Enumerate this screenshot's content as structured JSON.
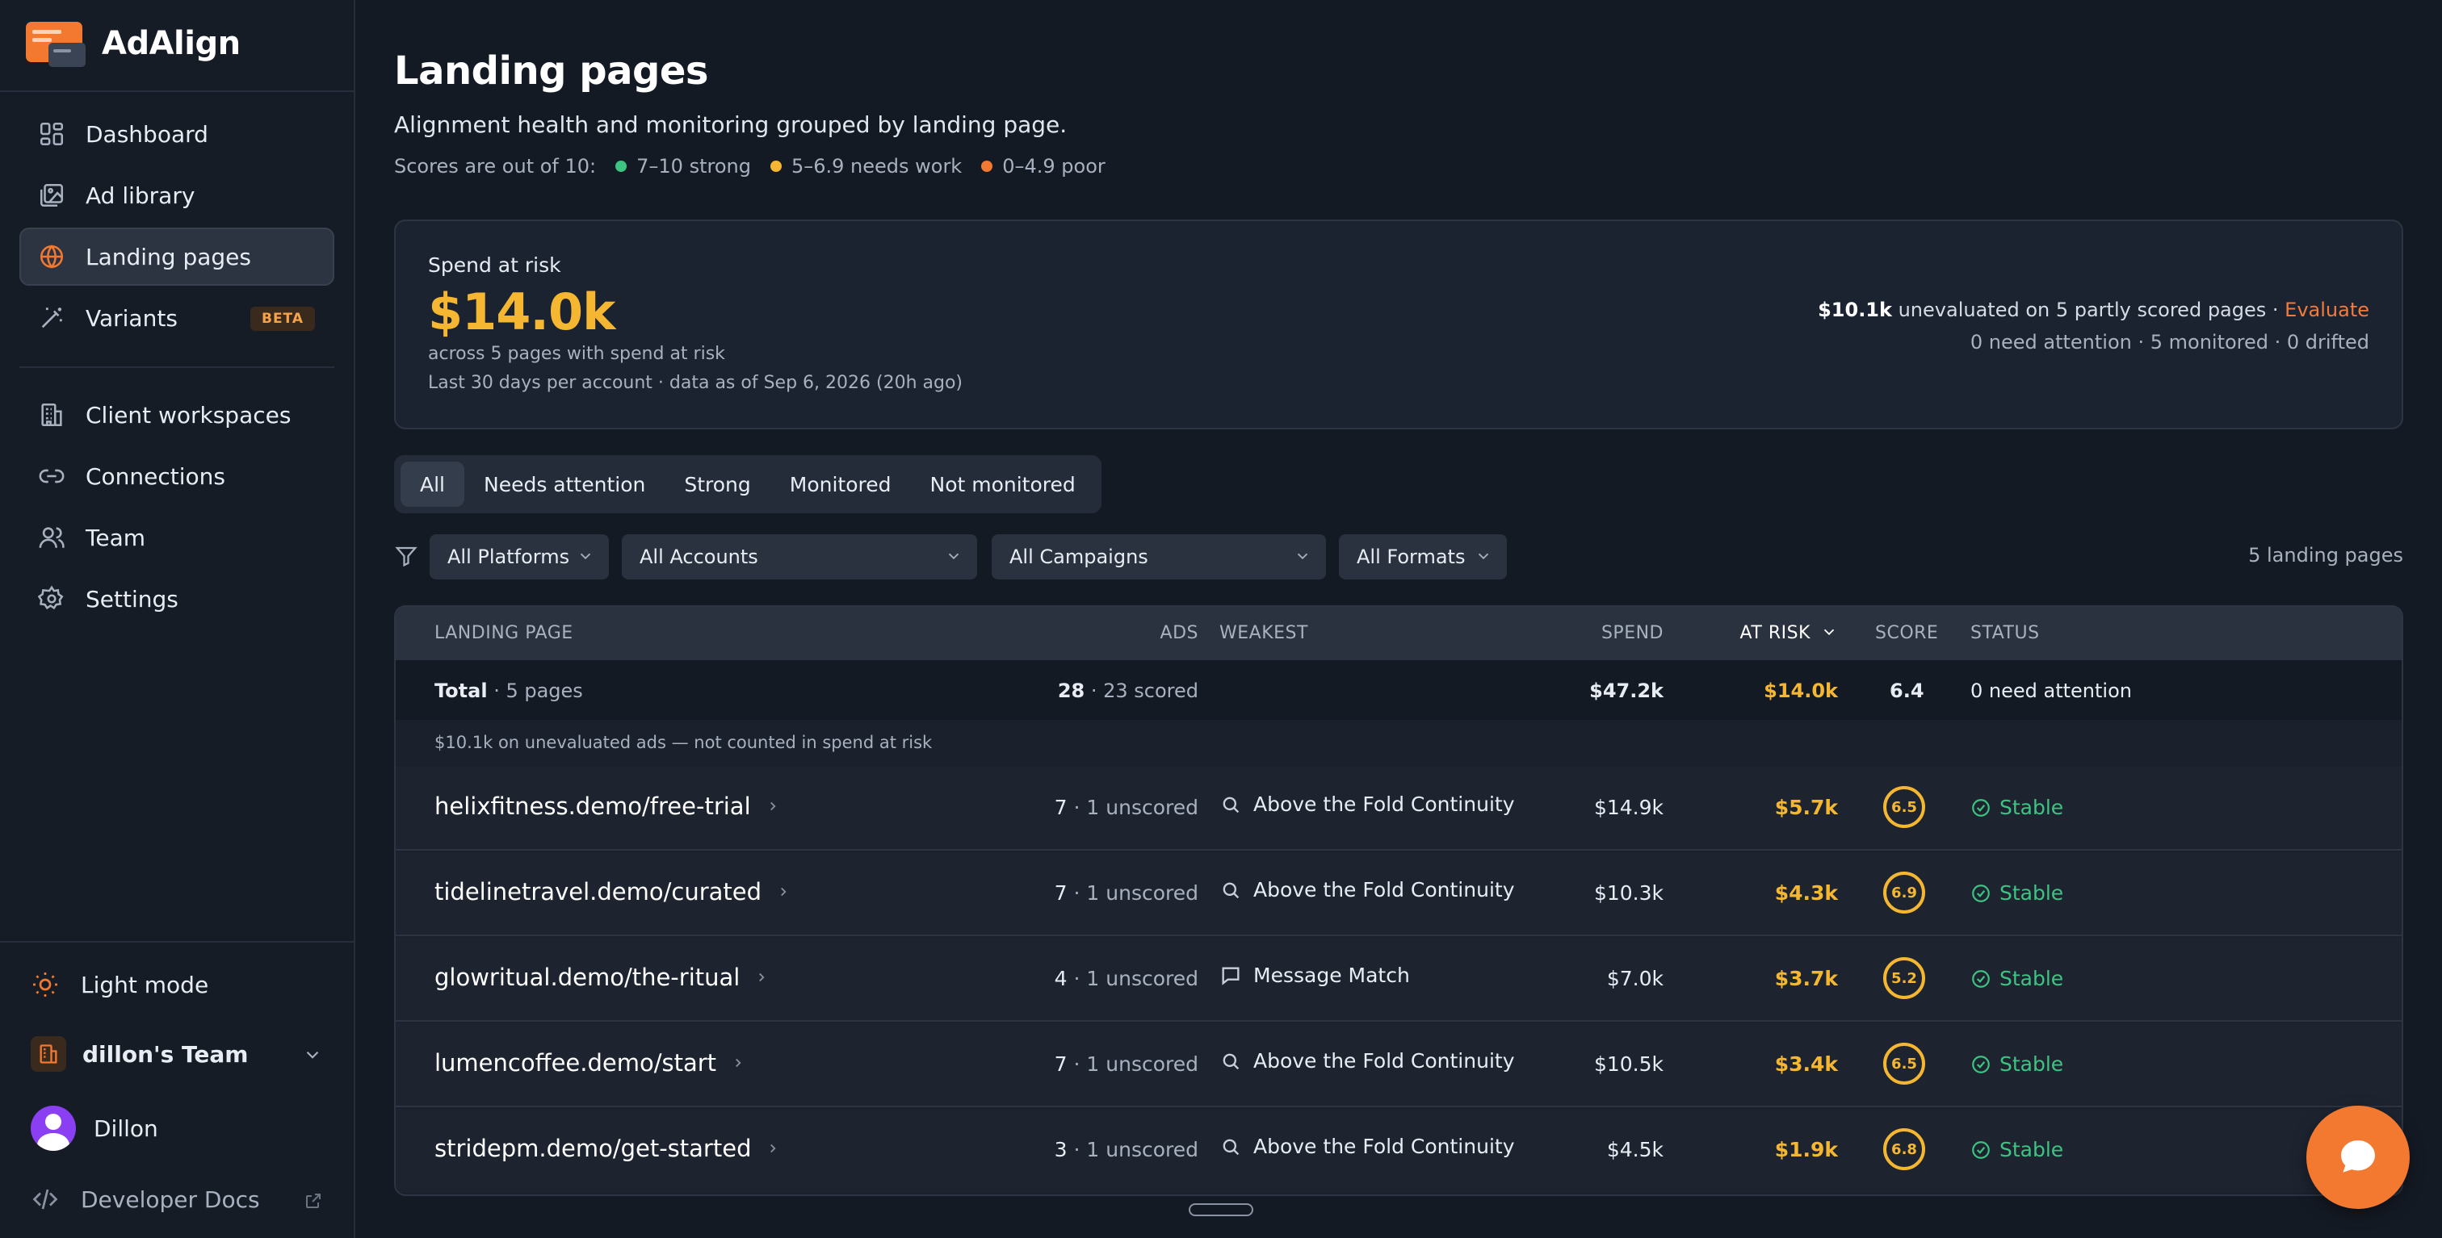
{
  "app": {
    "name": "AdAlign"
  },
  "sidebar": {
    "nav": [
      {
        "label": "Dashboard",
        "icon": "dashboard-icon"
      },
      {
        "label": "Ad library",
        "icon": "image-library-icon"
      },
      {
        "label": "Landing pages",
        "icon": "globe-icon",
        "active": true
      },
      {
        "label": "Variants",
        "icon": "magic-wand-icon",
        "badge": "BETA"
      }
    ],
    "nav2": [
      {
        "label": "Client workspaces",
        "icon": "building-icon"
      },
      {
        "label": "Connections",
        "icon": "link-icon"
      },
      {
        "label": "Team",
        "icon": "users-icon"
      },
      {
        "label": "Settings",
        "icon": "gear-icon"
      }
    ],
    "light_mode": "Light mode",
    "team_name": "dillon's Team",
    "user_name": "Dillon",
    "developer_docs": "Developer Docs"
  },
  "page": {
    "title": "Landing pages",
    "subtitle": "Alignment health and monitoring grouped by landing page.",
    "legend": {
      "prefix": "Scores are out of 10:",
      "strong": "7–10 strong",
      "needs_work": "5–6.9 needs work",
      "poor": "0–4.9 poor"
    },
    "colors": {
      "strong": "#3ec482",
      "needs_work": "#f5b731",
      "poor": "#f2792f",
      "accent": "#f2792f"
    }
  },
  "risk": {
    "label": "Spend at risk",
    "value": "$14.0k",
    "note1": "across 5 pages with spend at risk",
    "note2": "Last 30 days per account · data as of Sep 6, 2026 (20h ago)",
    "unevaluated_amount": "$10.1k",
    "unevaluated_text": " unevaluated on 5 partly scored pages · ",
    "evaluate": "Evaluate",
    "summary": "0 need attention · 5 monitored · 0 drifted"
  },
  "tabs": [
    "All",
    "Needs attention",
    "Strong",
    "Monitored",
    "Not monitored"
  ],
  "filters": {
    "platforms": "All Platforms",
    "accounts": "All Accounts",
    "campaigns": "All Campaigns",
    "formats": "All Formats",
    "count": "5 landing pages"
  },
  "table": {
    "headers": {
      "landing_page": "LANDING PAGE",
      "ads": "ADS",
      "weakest": "WEAKEST",
      "spend": "SPEND",
      "at_risk": "AT RISK",
      "score": "SCORE",
      "status": "STATUS"
    },
    "total": {
      "label": "Total",
      "pages": " · 5 pages",
      "ads": "28",
      "scored": " · 23 scored",
      "spend": "$47.2k",
      "at_risk": "$14.0k",
      "score": "6.4",
      "status": "0 need attention"
    },
    "note": "$10.1k on unevaluated ads — not counted in spend at risk",
    "rows": [
      {
        "page": "helixfitness.demo/free-trial",
        "ads": "7",
        "unscored": " · 1 unscored",
        "weakest": "Above the Fold Continuity",
        "weak_icon": "search-icon",
        "spend": "$14.9k",
        "at_risk": "$5.7k",
        "score": "6.5",
        "status": "Stable"
      },
      {
        "page": "tidelinetravel.demo/curated",
        "ads": "7",
        "unscored": " · 1 unscored",
        "weakest": "Above the Fold Continuity",
        "weak_icon": "search-icon",
        "spend": "$10.3k",
        "at_risk": "$4.3k",
        "score": "6.9",
        "status": "Stable"
      },
      {
        "page": "glowritual.demo/the-ritual",
        "ads": "4",
        "unscored": " · 1 unscored",
        "weakest": "Message Match",
        "weak_icon": "message-icon",
        "spend": "$7.0k",
        "at_risk": "$3.7k",
        "score": "5.2",
        "status": "Stable"
      },
      {
        "page": "lumencoffee.demo/start",
        "ads": "7",
        "unscored": " · 1 unscored",
        "weakest": "Above the Fold Continuity",
        "weak_icon": "search-icon",
        "spend": "$10.5k",
        "at_risk": "$3.4k",
        "score": "6.5",
        "status": "Stable"
      },
      {
        "page": "stridepm.demo/get-started",
        "ads": "3",
        "unscored": " · 1 unscored",
        "weakest": "Above the Fold Continuity",
        "weak_icon": "search-icon",
        "spend": "$4.5k",
        "at_risk": "$1.9k",
        "score": "6.8",
        "status": "Stable"
      }
    ]
  }
}
